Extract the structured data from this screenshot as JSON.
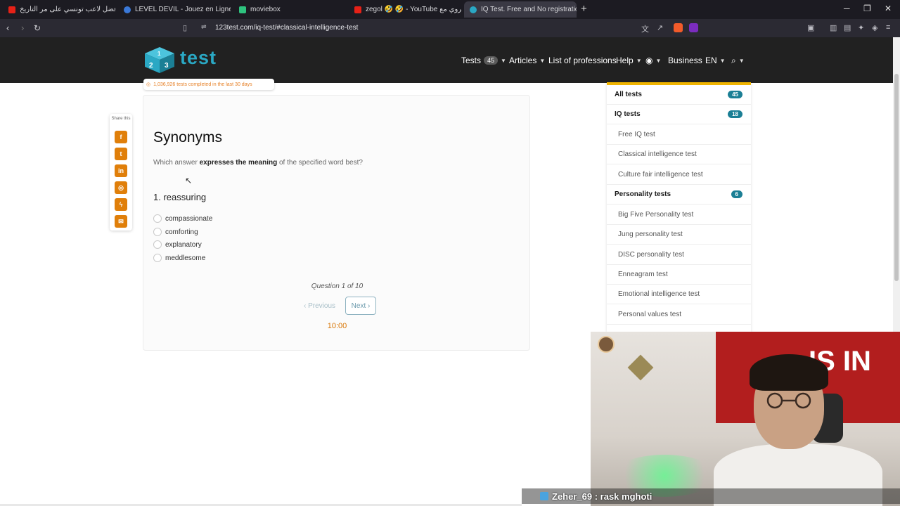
{
  "browser": {
    "tabs": [
      {
        "title": "أفضل لاعب تونسي على مر التاريخ",
        "active": false
      },
      {
        "title": "LEVEL DEVIL - Jouez en Ligne Gratuit",
        "active": false
      },
      {
        "title": "moviebox",
        "active": false
      },
      {
        "title": "zegol 🤣 🤣 - YouTube تحدي كروي مع",
        "active": false
      },
      {
        "title": "IQ Test. Free and No registration",
        "active": true
      }
    ],
    "url": "123test.com/iq-test/#classical-intelligence-test"
  },
  "site": {
    "logo_text": "test",
    "menu": {
      "tests": "Tests",
      "tests_count": "45",
      "articles": "Articles",
      "professions": "List of professions",
      "help": "Help",
      "business": "Business",
      "language": "EN"
    },
    "stats_text": "1,036,926 tests completed in the last 30 days"
  },
  "share": {
    "label": "Share this",
    "buttons": [
      "facebook",
      "twitter",
      "linkedin",
      "instagram",
      "messenger",
      "email"
    ]
  },
  "test": {
    "title": "Synonyms",
    "instruction_pre": "Which answer",
    "instruction_bold": "expresses the meaning",
    "instruction_post": "of the specified word best?",
    "question": "1. reassuring",
    "options": [
      "compassionate",
      "comforting",
      "explanatory",
      "meddlesome"
    ],
    "progress_text": "Question 1 of 10",
    "previous_label": "‹ Previous",
    "next_label": "Next ›",
    "timer": "10:00"
  },
  "sidebar": [
    {
      "label": "All tests",
      "count": "45",
      "type": "cat"
    },
    {
      "label": "IQ tests",
      "count": "18",
      "type": "cat"
    },
    {
      "label": "Free IQ test",
      "type": "sub"
    },
    {
      "label": "Classical intelligence test",
      "type": "sub"
    },
    {
      "label": "Culture fair intelligence test",
      "type": "sub"
    },
    {
      "label": "Personality tests",
      "count": "6",
      "type": "cat"
    },
    {
      "label": "Big Five Personality test",
      "type": "sub"
    },
    {
      "label": "Jung personality test",
      "type": "sub"
    },
    {
      "label": "DISC personality test",
      "type": "sub"
    },
    {
      "label": "Enneagram test",
      "type": "sub"
    },
    {
      "label": "Emotional intelligence test",
      "type": "sub"
    },
    {
      "label": "Personal values test",
      "type": "sub"
    }
  ],
  "stream": {
    "chat_user": "Zeher_69",
    "chat_message": ": rask mghoti",
    "banner_text": "IS IN"
  },
  "colors": {
    "accent": "#e07f0a",
    "brand": "#2aa8c4",
    "badge": "#1b7f95",
    "sidebar_top": "#f0b400"
  }
}
